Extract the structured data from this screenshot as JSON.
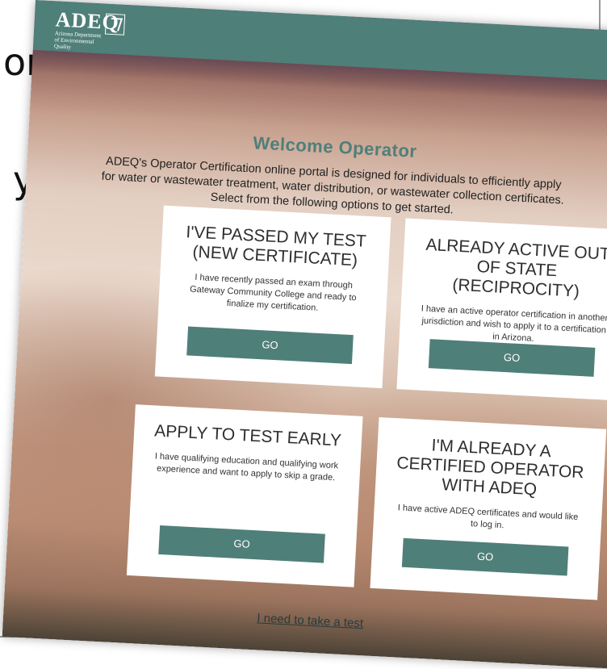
{
  "slide": {
    "fragment_top": "on",
    "fragment_mid": "y"
  },
  "header": {
    "logo_text": "ADEQ",
    "logo_subtext": "Arizona Department of Environmental Quality",
    "logo_icon": "arizona-state-icon"
  },
  "welcome": {
    "title": "Welcome Operator",
    "intro": "ADEQ's Operator Certification online portal is designed for individuals to efficiently apply for water or wastewater treatment, water distribution, or wastewater collection certificates. Select from the following options to get started."
  },
  "cards": [
    {
      "title": "I'VE PASSED MY TEST (NEW CERTIFICATE)",
      "body": "I have recently passed an exam through Gateway Community College and ready to finalize my certification.",
      "button": "GO"
    },
    {
      "title": "ALREADY ACTIVE OUT OF STATE (RECIPROCITY)",
      "body": "I have an active operator certification in another jurisdiction and wish to apply it to a certification in Arizona.",
      "button": "GO"
    },
    {
      "title": "APPLY TO TEST EARLY",
      "body": "I have qualifying education and qualifying work experience and want to apply to skip a grade.",
      "button": "GO"
    },
    {
      "title": "I'M ALREADY A CERTIFIED OPERATOR WITH ADEQ",
      "body": "I have active ADEQ certificates and would like to log in.",
      "button": "GO"
    }
  ],
  "footer": {
    "need_test_link": "I need to take a test"
  },
  "colors": {
    "brand_teal": "#4f7f79",
    "card_bg": "#ffffff"
  }
}
